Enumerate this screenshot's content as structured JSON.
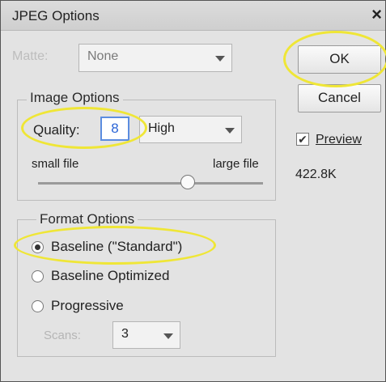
{
  "dialog": {
    "title": "JPEG Options",
    "close_glyph": "×"
  },
  "matte": {
    "label": "Matte:",
    "value": "None"
  },
  "buttons": {
    "ok": "OK",
    "cancel": "Cancel"
  },
  "image_options": {
    "legend": "Image Options",
    "quality_label": "Quality:",
    "quality_value": "8",
    "quality_preset": "High",
    "slider_min_label": "small file",
    "slider_max_label": "large file"
  },
  "preview": {
    "label": "Preview",
    "checked": true,
    "file_size": "422.8K"
  },
  "format_options": {
    "legend": "Format Options",
    "options": [
      {
        "label": "Baseline (\"Standard\")",
        "selected": true
      },
      {
        "label": "Baseline Optimized",
        "selected": false
      },
      {
        "label": "Progressive",
        "selected": false
      }
    ],
    "scans_label": "Scans:",
    "scans_value": "3"
  },
  "colors": {
    "highlight": "#efe636",
    "focus": "#5c8de0"
  }
}
